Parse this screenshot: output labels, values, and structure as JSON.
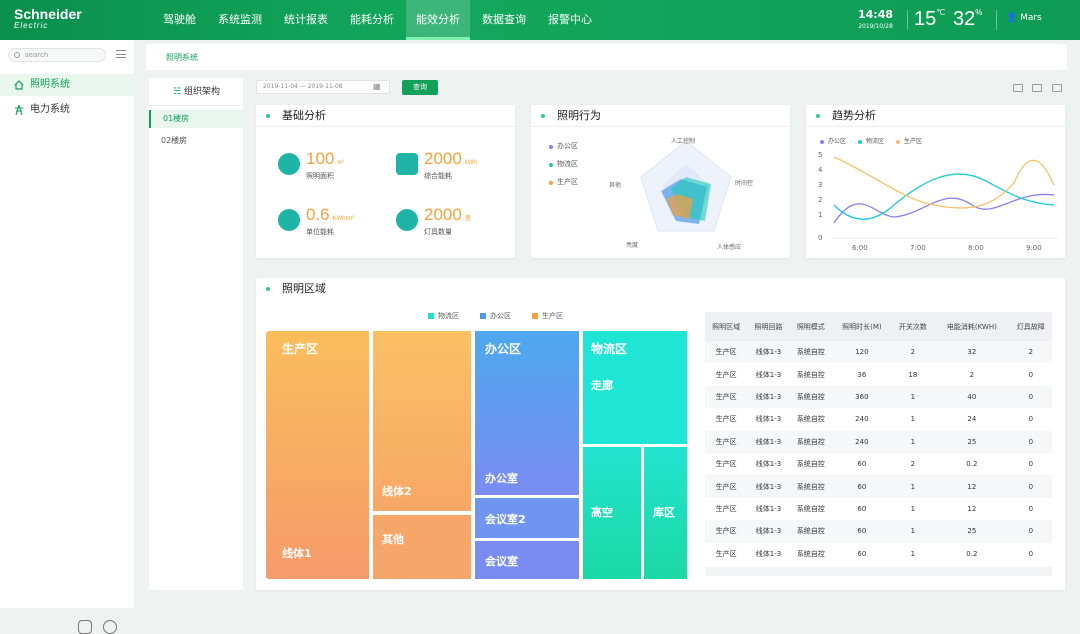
{
  "header": {
    "logo_top": "Schneider",
    "logo_bottom": "Electric",
    "nav": [
      "驾驶舱",
      "系统监测",
      "统计报表",
      "能耗分析",
      "能效分析",
      "数据查询",
      "报警中心"
    ],
    "time": "14:48",
    "date": "2019/10/28",
    "temperature": "15",
    "temp_unit": "℃",
    "humidity": "32",
    "hum_unit": "%",
    "user": "Mars"
  },
  "sidebar": {
    "search_placeholder": "search",
    "items": [
      "照明系统",
      "电力系统"
    ]
  },
  "breadcrumb": "照明系统",
  "tree": {
    "title": "组织架构",
    "items": [
      "01楼房",
      "02楼房"
    ]
  },
  "filter": {
    "start": "2019-11-04",
    "dash": "—",
    "end": "2019-11-08",
    "button": "查询"
  },
  "basic": {
    "title": "基础分析",
    "kpis": [
      {
        "value": "100",
        "unit": "m²",
        "label": "照明面积"
      },
      {
        "value": "2000",
        "unit": "kWh",
        "label": "综合能耗"
      },
      {
        "value": "0.6",
        "unit": "KWh/m²",
        "label": "单位能耗"
      },
      {
        "value": "2000",
        "unit": "盏",
        "label": "灯具数量"
      }
    ]
  },
  "behavior": {
    "title": "照明行为",
    "legend": [
      "办公区",
      "物流区",
      "生产区"
    ],
    "axes": [
      "人工控制",
      "时间控",
      "人体感应",
      "亮度",
      "其他"
    ]
  },
  "trend": {
    "title": "趋势分析",
    "legend": [
      "办公区",
      "物流区",
      "生产区"
    ],
    "yticks": [
      "5",
      "4",
      "3",
      "2",
      "1",
      "0"
    ],
    "xticks": [
      "6:00",
      "7:00",
      "8:00",
      "9:00"
    ]
  },
  "region": {
    "title": "照明区域",
    "legend": [
      "物流区",
      "办公区",
      "生产区"
    ],
    "treemap": [
      "生产区",
      "线体2",
      "线体1",
      "其他",
      "办公区",
      "办公室",
      "会议室2",
      "会议室",
      "物流区",
      "走廊",
      "高空",
      "库区"
    ],
    "table": {
      "headers": [
        "照明区域",
        "照明回路",
        "照明模式",
        "照明时长(M)",
        "开关次数",
        "电能消耗(KWH)",
        "灯具故障"
      ],
      "rows": [
        [
          "生产区",
          "线体1-3",
          "系统自控",
          "120",
          "2",
          "32",
          "2"
        ],
        [
          "生产区",
          "线体1-3",
          "系统自控",
          "36",
          "18",
          "2",
          "0"
        ],
        [
          "生产区",
          "线体1-3",
          "系统自控",
          "360",
          "1",
          "40",
          "0"
        ],
        [
          "生产区",
          "线体1-3",
          "系统自控",
          "240",
          "1",
          "24",
          "0"
        ],
        [
          "生产区",
          "线体1-3",
          "系统自控",
          "240",
          "1",
          "25",
          "0"
        ],
        [
          "生产区",
          "线体1-3",
          "系统自控",
          "60",
          "2",
          "0.2",
          "0"
        ],
        [
          "生产区",
          "线体1-3",
          "系统自控",
          "60",
          "1",
          "12",
          "0"
        ],
        [
          "生产区",
          "线体1-3",
          "系统自控",
          "60",
          "1",
          "12",
          "0"
        ],
        [
          "生产区",
          "线体1-3",
          "系统自控",
          "60",
          "1",
          "25",
          "0"
        ],
        [
          "生产区",
          "线体1-3",
          "系统自控",
          "60",
          "1",
          "0.2",
          "0"
        ]
      ]
    }
  },
  "colors": {
    "brand": "#12a05a",
    "orange": "#f5a03a",
    "blue": "#4d9ae8",
    "cyan": "#1fe0c8",
    "purple": "#8b7ff0"
  }
}
